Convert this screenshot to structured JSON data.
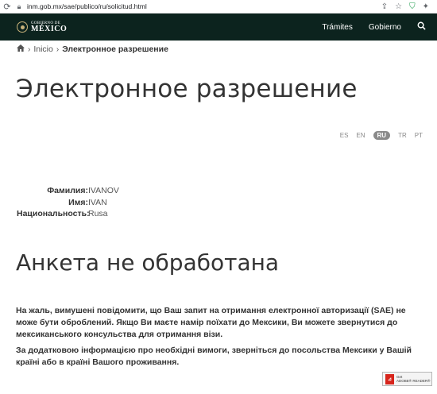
{
  "browser": {
    "url": "inm.gob.mx/sae/publico/ru/solicitud.html"
  },
  "header": {
    "logo_top": "GOBIERNO DE",
    "logo_main": "MÉXICO",
    "nav": [
      {
        "label": "Trámites"
      },
      {
        "label": "Gobierno"
      }
    ]
  },
  "breadcrumb": {
    "home_label": "Inicio",
    "current": "Электронное разрешение"
  },
  "page_title": "Электронное разрешение",
  "languages": [
    {
      "code": "ES",
      "active": false
    },
    {
      "code": "EN",
      "active": false
    },
    {
      "code": "RU",
      "active": true
    },
    {
      "code": "TR",
      "active": false
    },
    {
      "code": "PT",
      "active": false
    }
  ],
  "applicant": {
    "surname_label": "Фамилия:",
    "surname": "IVANOV",
    "name_label": "Имя:",
    "name": "IVAN",
    "nationality_label": "Национальность:",
    "nationality": "Rusa"
  },
  "status_title": "Анкета не обработана",
  "message1": "На жаль, вимушені повідомити, що Ваш запит на отримання електронної авторизації (SAE) не може бути оброблений. Якщо Ви маєте намір поїхати до Мексики, Ви можете звернутися до мексиканського консульства для отримання візи.",
  "message2": "За додатковою інформацією про необхідні вимоги, зверніться до посольства Мексики у Вашій країні або в країні Вашого проживання.",
  "adobe_badge": {
    "line1": "Get",
    "line2": "ADOBE® READER®"
  },
  "colors": {
    "header_bg": "#0c231e",
    "text": "#333333",
    "badge_active": "#8a8a8a"
  }
}
